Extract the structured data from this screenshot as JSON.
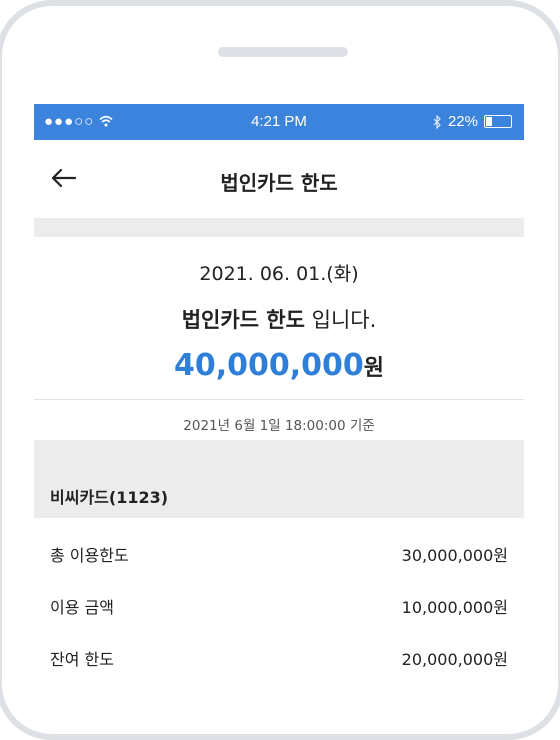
{
  "status_bar": {
    "signal": "●●●○○",
    "wifi_icon": "wifi-icon",
    "time": "4:21 PM",
    "bluetooth_icon": "bluetooth-icon",
    "battery": "22%",
    "battery_level": 0.22
  },
  "header": {
    "title": "법인카드 한도",
    "back_icon": "arrow-left-icon"
  },
  "summary": {
    "date": "2021. 06. 01.(화)",
    "line_bold": "법인카드 한도",
    "line_rest": " 입니다.",
    "amount": "40,000,000",
    "unit": "원"
  },
  "basis": "2021년 6월 1일 18:00:00 기준",
  "card": {
    "name": "비씨카드(1123)",
    "rows": [
      {
        "label": "총 이용한도",
        "value": "30,000,000",
        "unit": "원"
      },
      {
        "label": "이용 금액",
        "value": "10,000,000",
        "unit": "원"
      },
      {
        "label": "잔여 한도",
        "value": "20,000,000",
        "unit": "원"
      }
    ]
  },
  "colors": {
    "accent": "#3b83dd",
    "amount": "#2f7fd8",
    "band": "#ececec"
  }
}
